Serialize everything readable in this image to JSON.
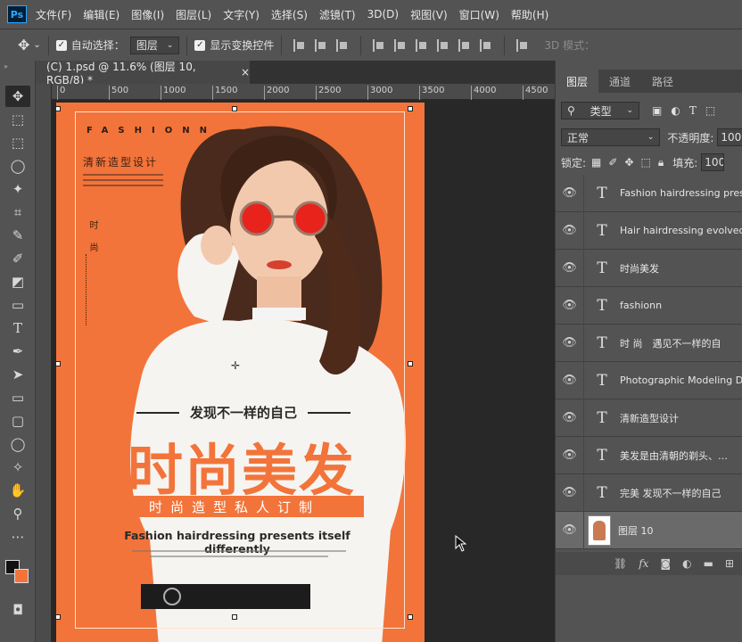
{
  "app": {
    "logo": "Ps",
    "menu": [
      "文件(F)",
      "编辑(E)",
      "图像(I)",
      "图层(L)",
      "文字(Y)",
      "选择(S)",
      "滤镜(T)",
      "3D(D)",
      "视图(V)",
      "窗口(W)",
      "帮助(H)"
    ]
  },
  "options": {
    "auto_select_label": "自动选择：",
    "auto_select_value": "图层",
    "show_transform_label": "显示变换控件",
    "mode_3d_label": "3D 模式："
  },
  "document": {
    "tab_title": "(C) 1.psd @ 11.6% (图层 10, RGB/8) *",
    "close": "×"
  },
  "ruler": {
    "ticks": [
      "0",
      "500",
      "1000",
      "1500",
      "2000",
      "2500",
      "3000",
      "3500",
      "4000",
      "4500"
    ]
  },
  "poster": {
    "brand": "FASHIONN",
    "sub_cn": "清新造型设计",
    "vertical_cn": "时 尚",
    "discover": "发现不一样的自己",
    "big_title": "时尚美发",
    "band": "时尚造型私人订制",
    "fashion_en": "Fashion hairdressing presents itself differently"
  },
  "layers_panel": {
    "tabs": [
      "图层",
      "通道",
      "路径"
    ],
    "filter_kind": "类型",
    "blend_mode": "正常",
    "opacity_label": "不透明度:",
    "opacity_value": "100",
    "lock_label": "锁定:",
    "fill_label": "填充:",
    "fill_value": "100",
    "layers": [
      {
        "type": "T",
        "name": "Fashion hairdressing pres…"
      },
      {
        "type": "T",
        "name": "Hair hairdressing evolved"
      },
      {
        "type": "T",
        "name": "时尚美发"
      },
      {
        "type": "T",
        "name": "fashionn"
      },
      {
        "type": "T",
        "name": "时 尚　遇见不一样的自"
      },
      {
        "type": "T",
        "name": "Photographic Modeling De"
      },
      {
        "type": "T",
        "name": "清新造型设计"
      },
      {
        "type": "T",
        "name": "美发是由清朝的剃头、…"
      },
      {
        "type": "T",
        "name": "完美 发现不一样的自己"
      },
      {
        "type": "image",
        "name": "图层 10"
      }
    ]
  },
  "colors": {
    "poster_orange": "#f2743a",
    "panel_bg": "#535353",
    "canvas_bg": "#282828"
  }
}
